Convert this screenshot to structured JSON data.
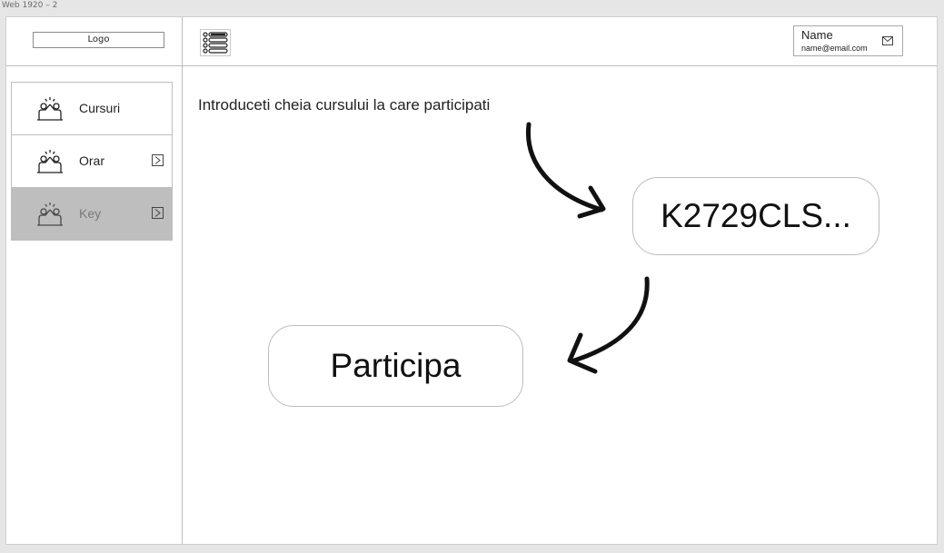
{
  "artboard": {
    "label": "Web 1920 – 2"
  },
  "sidebar": {
    "logo_label": "Logo",
    "items": [
      {
        "label": "Cursuri",
        "icon": "team-icon",
        "chevron": false,
        "active": false
      },
      {
        "label": "Orar",
        "icon": "team-icon",
        "chevron": true,
        "active": false
      },
      {
        "label": "Key",
        "icon": "team-icon",
        "chevron": true,
        "active": true
      }
    ]
  },
  "header": {
    "menu_icon": "hamburger-list-icon",
    "user": {
      "name": "Name",
      "email": "name@email.com",
      "icon": "mail-icon"
    }
  },
  "main": {
    "instruction": "Introduceti cheia cursului la care participati",
    "key_value": "K2729CLS...",
    "join_label": "Participa"
  }
}
